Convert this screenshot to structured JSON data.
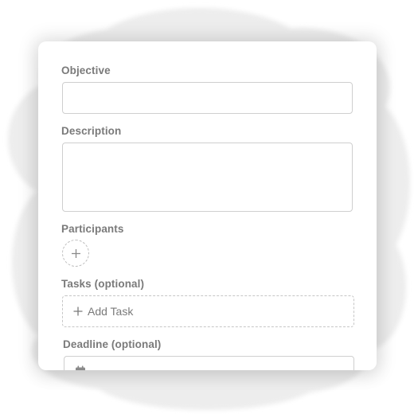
{
  "form": {
    "objective": {
      "label": "Objective",
      "value": ""
    },
    "description": {
      "label": "Description",
      "value": ""
    },
    "participants": {
      "label": "Participants",
      "add_icon": "plus-icon"
    },
    "tasks": {
      "label": "Tasks (optional)",
      "add_label": "Add Task",
      "add_icon": "plus-icon"
    },
    "deadline": {
      "label": "Deadline (optional)",
      "icon": "calendar-icon",
      "value": ""
    }
  },
  "colors": {
    "label_text": "#7a7a7a",
    "border": "#cfcfcf",
    "dashed_border": "#c6c6c6",
    "icon": "#8a8a8a",
    "card_background": "#ffffff",
    "backdrop_blob": "#ececec"
  }
}
